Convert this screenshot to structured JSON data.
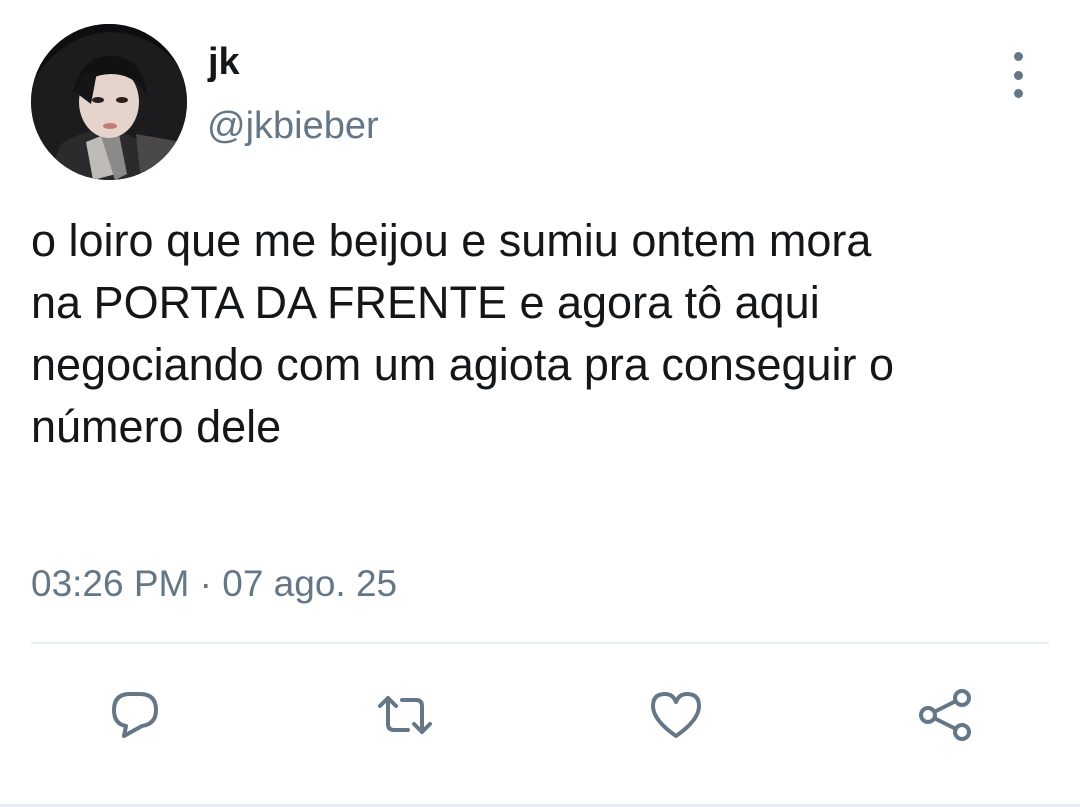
{
  "author": {
    "display_name": "jk",
    "handle": "@jkbieber"
  },
  "tweet": {
    "text_lines": [
      "o loiro que me beijou e sumiu ontem mora",
      "na PORTA DA FRENTE e agora tô aqui",
      "negociando com um agiota pra conseguir o",
      "número dele"
    ],
    "timestamp": "03:26 PM · 07 ago. 25"
  },
  "actions": [
    {
      "name": "reply",
      "icon": "reply-icon"
    },
    {
      "name": "retweet",
      "icon": "retweet-icon"
    },
    {
      "name": "like",
      "icon": "heart-icon"
    },
    {
      "name": "share",
      "icon": "share-icon"
    }
  ],
  "colors": {
    "primary_text": "#14171a",
    "secondary_text": "#657786",
    "divider": "#e6ecf0"
  }
}
